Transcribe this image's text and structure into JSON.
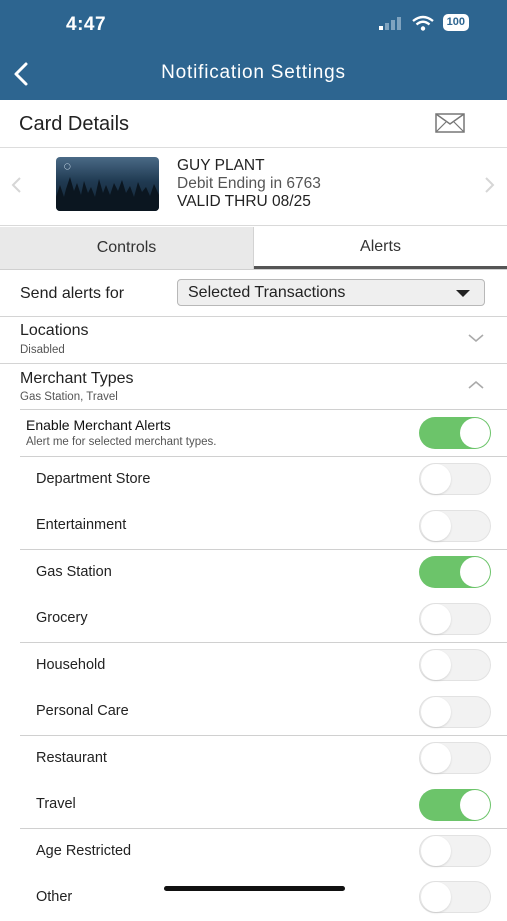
{
  "status_bar": {
    "time": "4:47",
    "battery": "100"
  },
  "header": {
    "title": "Notification Settings"
  },
  "card_details": {
    "label": "Card Details"
  },
  "card": {
    "holder": "GUY PLANT",
    "ending": "Debit Ending in 6763",
    "valid": "VALID THRU 08/25"
  },
  "tabs": [
    {
      "label": "Controls",
      "selected": false
    },
    {
      "label": "Alerts",
      "selected": true
    }
  ],
  "send_alerts": {
    "label": "Send alerts for",
    "value": "Selected Transactions"
  },
  "locations": {
    "title": "Locations",
    "status": "Disabled"
  },
  "merchant_types": {
    "title": "Merchant Types",
    "summary": "Gas Station, Travel",
    "enable_title": "Enable Merchant Alerts",
    "enable_sub": "Alert me for selected merchant types.",
    "enable_on": true,
    "items": [
      {
        "label": "Department Store",
        "on": false
      },
      {
        "label": "Entertainment",
        "on": false
      },
      {
        "label": "Gas Station",
        "on": true
      },
      {
        "label": "Grocery",
        "on": false
      },
      {
        "label": "Household",
        "on": false
      },
      {
        "label": "Personal Care",
        "on": false
      },
      {
        "label": "Restaurant",
        "on": false
      },
      {
        "label": "Travel",
        "on": true
      },
      {
        "label": "Age Restricted",
        "on": false
      },
      {
        "label": "Other",
        "on": false
      }
    ]
  },
  "colors": {
    "header": "#2d6590",
    "toggle_on": "#6cc46a",
    "toggle_off": "#f2f2f2"
  }
}
